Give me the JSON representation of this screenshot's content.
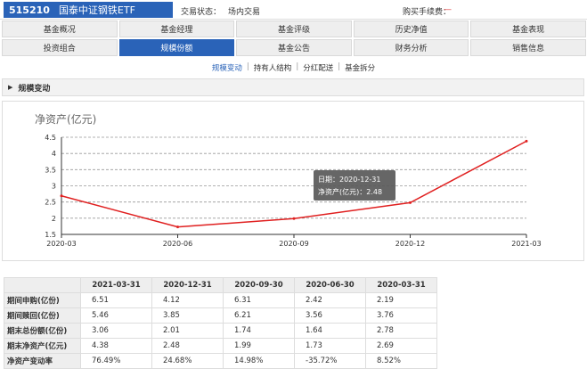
{
  "header": {
    "fund_code": "515210",
    "fund_name": "国泰中证钢铁ETF",
    "trade_status_label": "交易状态：",
    "trade_status_value": "场内交易",
    "fee_label": "购买手续费：",
    "fee_value": "—"
  },
  "tabs": {
    "row1": [
      "基金概况",
      "基金经理",
      "基金评级",
      "历史净值",
      "基金表现"
    ],
    "row2": [
      "投资组合",
      "规模份额",
      "基金公告",
      "财务分析",
      "销售信息"
    ],
    "active": "规模份额"
  },
  "subnav": {
    "items": [
      "规模变动",
      "持有人结构",
      "分红配送",
      "基金拆分"
    ],
    "active": "规模变动"
  },
  "section": {
    "title": "规模变动"
  },
  "chart_data": {
    "type": "line",
    "title": "净资产(亿元)",
    "x": [
      "2020-03",
      "2020-06",
      "2020-09",
      "2020-12",
      "2021-03"
    ],
    "series": [
      {
        "name": "净资产(亿元)",
        "values": [
          2.69,
          1.73,
          1.99,
          2.48,
          4.38
        ]
      }
    ],
    "yticks": [
      "1.5",
      "2",
      "2.5",
      "3",
      "3.5",
      "4",
      "4.5"
    ],
    "ylim": [
      1.5,
      4.5
    ],
    "grid": true,
    "line_color": "#e02020",
    "tooltip": {
      "date_label": "日期：2020-12-31",
      "value_label": "净资产(亿元)：2.48"
    }
  },
  "table": {
    "columns": [
      "2021-03-31",
      "2020-12-31",
      "2020-09-30",
      "2020-06-30",
      "2020-03-31"
    ],
    "rows": [
      {
        "label": "期间申购(亿份)",
        "values": [
          "6.51",
          "4.12",
          "6.31",
          "2.42",
          "2.19"
        ]
      },
      {
        "label": "期间赎回(亿份)",
        "values": [
          "5.46",
          "3.85",
          "6.21",
          "3.56",
          "3.76"
        ]
      },
      {
        "label": "期末总份额(亿份)",
        "values": [
          "3.06",
          "2.01",
          "1.74",
          "1.64",
          "2.78"
        ]
      },
      {
        "label": "期末净资产(亿元)",
        "values": [
          "4.38",
          "2.48",
          "1.99",
          "1.73",
          "2.69"
        ]
      },
      {
        "label": "净资产变动率",
        "values": [
          "76.49%",
          "24.68%",
          "14.98%",
          "-35.72%",
          "8.52%"
        ]
      }
    ]
  },
  "colors": {
    "accent": "#2a63b8",
    "line": "#e02020",
    "fee": "#e03030"
  }
}
